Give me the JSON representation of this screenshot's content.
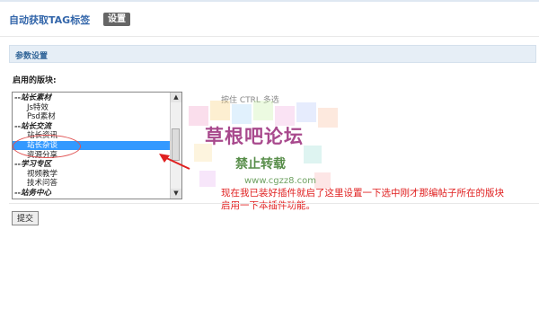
{
  "header": {
    "title": "自动获取TAG标签",
    "settings_label": "设置"
  },
  "section": {
    "title": "参数设置"
  },
  "field": {
    "label": "启用的版块:",
    "hint": "按住 CTRL 多选"
  },
  "listbox": {
    "options": [
      {
        "label": "--站长素材",
        "type": "group"
      },
      {
        "label": "Js特效",
        "type": "item"
      },
      {
        "label": "Psd素材",
        "type": "item"
      },
      {
        "label": "--站长交流",
        "type": "group"
      },
      {
        "label": "站长资讯",
        "type": "item"
      },
      {
        "label": "站长杂谈",
        "type": "item",
        "selected": true
      },
      {
        "label": "资源分享",
        "type": "item"
      },
      {
        "label": "--学习专区",
        "type": "group"
      },
      {
        "label": "视频教学",
        "type": "item"
      },
      {
        "label": "技术问答",
        "type": "item"
      },
      {
        "label": "--站务中心",
        "type": "group"
      }
    ]
  },
  "watermark": {
    "main": "草根吧论坛",
    "sub": "禁止转载",
    "url": "www.cgzz8.com"
  },
  "annotation": {
    "line1": "现在我已装好插件就启了这里设置一下选中刚才那编帖子所在的版块",
    "line2": "启用一下本插件功能。"
  },
  "buttons": {
    "submit_label": "提交"
  },
  "colors": {
    "title": "#3366aa",
    "selection": "#3399ff",
    "annotation": "#e02020"
  }
}
